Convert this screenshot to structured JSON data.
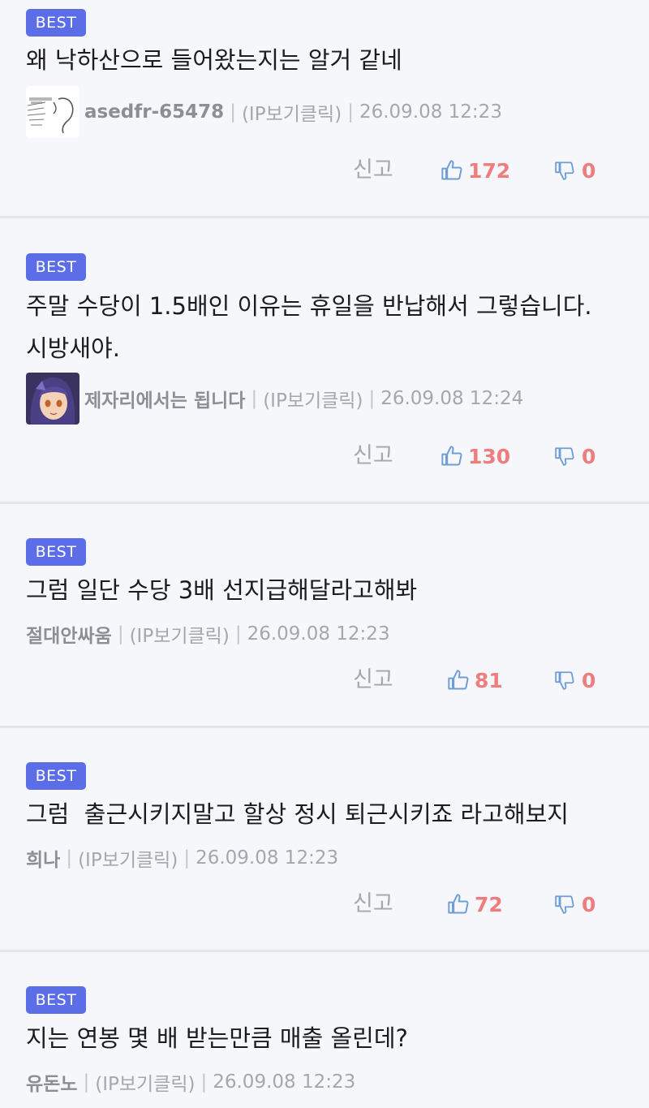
{
  "comments": [
    {
      "badge": "BEST",
      "text": "왜 낙하산으로 들어왔는지는 알거 같네",
      "author": "asedfr-65478",
      "ip_label": "(IP보기클릭)",
      "time": "26.09.08 12:23",
      "report_label": "신고",
      "likes": "172",
      "dislikes": "0",
      "avatar": "sketch-avatar"
    },
    {
      "badge": "BEST",
      "text": "주말 수당이 1.5배인 이유는 휴일을 반납해서 그렇습니다.\n시방새야.",
      "author": "제자리에서는 됩니다",
      "ip_label": "(IP보기클릭)",
      "time": "26.09.08 12:24",
      "report_label": "신고",
      "likes": "130",
      "dislikes": "0",
      "avatar": "anime-avatar"
    },
    {
      "badge": "BEST",
      "text": "그럼 일단 수당 3배 선지급해달라고해봐",
      "author": "절대안싸움",
      "ip_label": "(IP보기클릭)",
      "time": "26.09.08 12:23",
      "report_label": "신고",
      "likes": "81",
      "dislikes": "0"
    },
    {
      "badge": "BEST",
      "text": "그럼  출근시키지말고 할상 정시 퇴근시키죠 라고해보지",
      "author": "희나",
      "ip_label": "(IP보기클릭)",
      "time": "26.09.08 12:23",
      "report_label": "신고",
      "likes": "72",
      "dislikes": "0"
    },
    {
      "badge": "BEST",
      "text": "지는 연봉 몇 배 받는만큼 매출 올린데?",
      "author": "유돈노",
      "ip_label": "(IP보기클릭)",
      "time": "26.09.08 12:23"
    }
  ],
  "icons": {
    "like": "thumbs-up-icon",
    "dislike": "thumbs-down-icon"
  },
  "colors": {
    "badge": "#5b6ee8",
    "count": "#ef7d7d",
    "thumb_icon": "#6f9ed6",
    "background": "#f5f7fb"
  }
}
